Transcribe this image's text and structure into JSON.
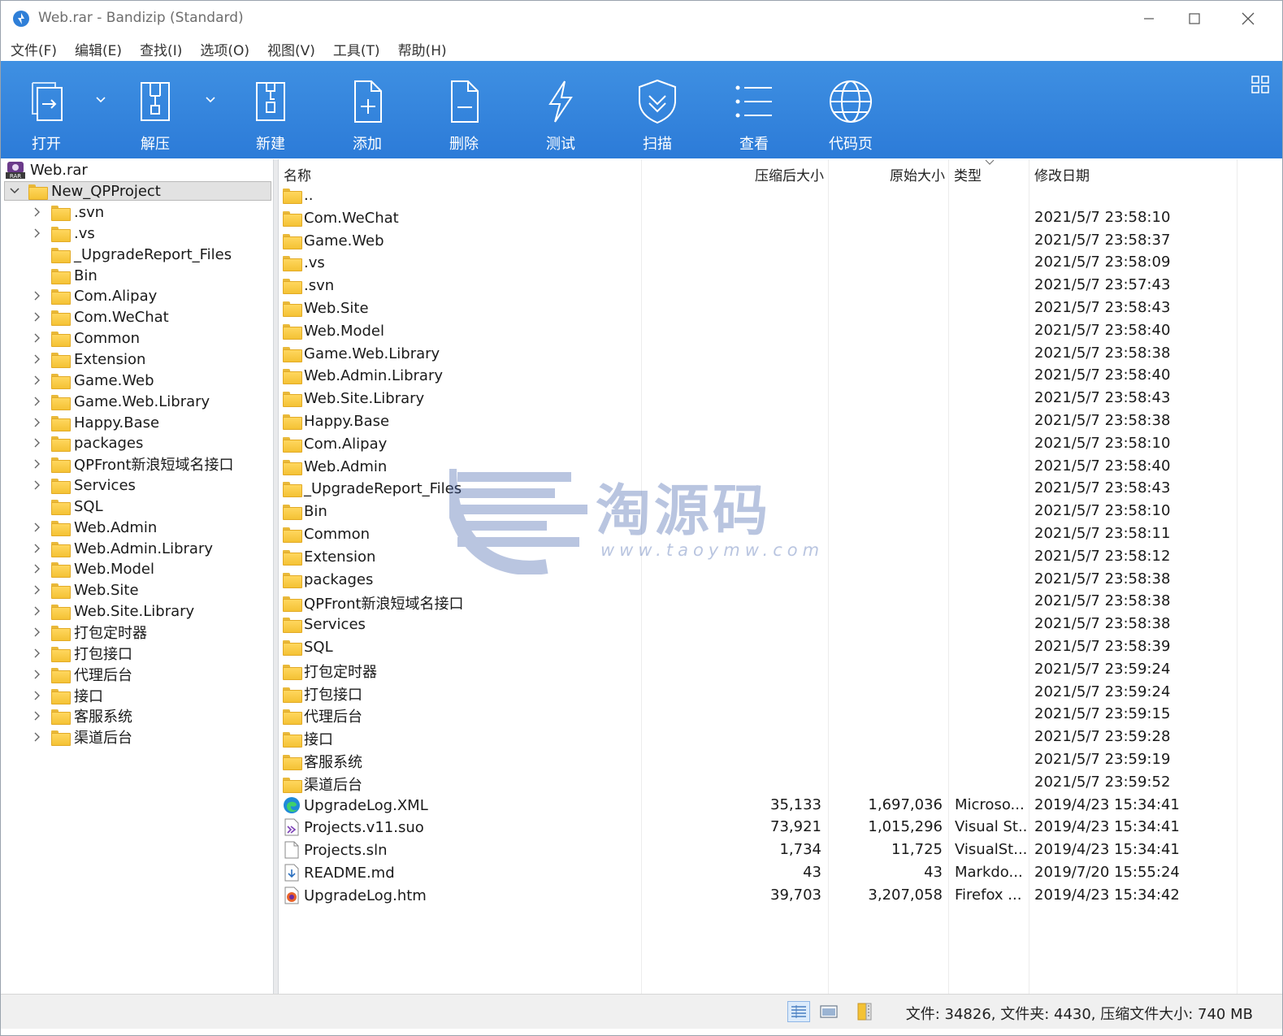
{
  "window": {
    "title": "Web.rar - Bandizip (Standard)"
  },
  "menu": [
    "文件(F)",
    "编辑(E)",
    "查找(I)",
    "选项(O)",
    "视图(V)",
    "工具(T)",
    "帮助(H)"
  ],
  "toolbar": {
    "open": "打开",
    "extract": "解压",
    "new": "新建",
    "add": "添加",
    "delete": "删除",
    "test": "测试",
    "scan": "扫描",
    "view": "查看",
    "codepage": "代码页"
  },
  "tree": {
    "root": "Web.rar",
    "selected": "New_QPProject",
    "children": [
      {
        "label": ".svn",
        "expandable": true
      },
      {
        "label": ".vs",
        "expandable": true
      },
      {
        "label": "_UpgradeReport_Files",
        "expandable": false
      },
      {
        "label": "Bin",
        "expandable": false
      },
      {
        "label": "Com.Alipay",
        "expandable": true
      },
      {
        "label": "Com.WeChat",
        "expandable": true
      },
      {
        "label": "Common",
        "expandable": true
      },
      {
        "label": "Extension",
        "expandable": true
      },
      {
        "label": "Game.Web",
        "expandable": true
      },
      {
        "label": "Game.Web.Library",
        "expandable": true
      },
      {
        "label": "Happy.Base",
        "expandable": true
      },
      {
        "label": "packages",
        "expandable": true
      },
      {
        "label": "QPFront新浪短域名接口",
        "expandable": true
      },
      {
        "label": "Services",
        "expandable": true
      },
      {
        "label": "SQL",
        "expandable": false
      },
      {
        "label": "Web.Admin",
        "expandable": true
      },
      {
        "label": "Web.Admin.Library",
        "expandable": true
      },
      {
        "label": "Web.Model",
        "expandable": true
      },
      {
        "label": "Web.Site",
        "expandable": true
      },
      {
        "label": "Web.Site.Library",
        "expandable": true
      },
      {
        "label": "打包定时器",
        "expandable": true
      },
      {
        "label": "打包接口",
        "expandable": true
      },
      {
        "label": "代理后台",
        "expandable": true
      },
      {
        "label": "接口",
        "expandable": true
      },
      {
        "label": "客服系统",
        "expandable": true
      },
      {
        "label": "渠道后台",
        "expandable": true
      }
    ]
  },
  "columns": {
    "name": "名称",
    "packed": "压缩后大小",
    "size": "原始大小",
    "type": "类型",
    "modified": "修改日期"
  },
  "files": [
    {
      "name": "..",
      "packed": "",
      "size": "",
      "type": "",
      "modified": "",
      "icon": "folder"
    },
    {
      "name": "Com.WeChat",
      "packed": "",
      "size": "",
      "type": "",
      "modified": "2021/5/7 23:58:10",
      "icon": "folder"
    },
    {
      "name": "Game.Web",
      "packed": "",
      "size": "",
      "type": "",
      "modified": "2021/5/7 23:58:37",
      "icon": "folder"
    },
    {
      "name": ".vs",
      "packed": "",
      "size": "",
      "type": "",
      "modified": "2021/5/7 23:58:09",
      "icon": "folder"
    },
    {
      "name": ".svn",
      "packed": "",
      "size": "",
      "type": "",
      "modified": "2021/5/7 23:57:43",
      "icon": "folder"
    },
    {
      "name": "Web.Site",
      "packed": "",
      "size": "",
      "type": "",
      "modified": "2021/5/7 23:58:43",
      "icon": "folder"
    },
    {
      "name": "Web.Model",
      "packed": "",
      "size": "",
      "type": "",
      "modified": "2021/5/7 23:58:40",
      "icon": "folder"
    },
    {
      "name": "Game.Web.Library",
      "packed": "",
      "size": "",
      "type": "",
      "modified": "2021/5/7 23:58:38",
      "icon": "folder"
    },
    {
      "name": "Web.Admin.Library",
      "packed": "",
      "size": "",
      "type": "",
      "modified": "2021/5/7 23:58:40",
      "icon": "folder"
    },
    {
      "name": "Web.Site.Library",
      "packed": "",
      "size": "",
      "type": "",
      "modified": "2021/5/7 23:58:43",
      "icon": "folder"
    },
    {
      "name": "Happy.Base",
      "packed": "",
      "size": "",
      "type": "",
      "modified": "2021/5/7 23:58:38",
      "icon": "folder"
    },
    {
      "name": "Com.Alipay",
      "packed": "",
      "size": "",
      "type": "",
      "modified": "2021/5/7 23:58:10",
      "icon": "folder"
    },
    {
      "name": "Web.Admin",
      "packed": "",
      "size": "",
      "type": "",
      "modified": "2021/5/7 23:58:40",
      "icon": "folder"
    },
    {
      "name": "_UpgradeReport_Files",
      "packed": "",
      "size": "",
      "type": "",
      "modified": "2021/5/7 23:58:43",
      "icon": "folder"
    },
    {
      "name": "Bin",
      "packed": "",
      "size": "",
      "type": "",
      "modified": "2021/5/7 23:58:10",
      "icon": "folder"
    },
    {
      "name": "Common",
      "packed": "",
      "size": "",
      "type": "",
      "modified": "2021/5/7 23:58:11",
      "icon": "folder"
    },
    {
      "name": "Extension",
      "packed": "",
      "size": "",
      "type": "",
      "modified": "2021/5/7 23:58:12",
      "icon": "folder"
    },
    {
      "name": "packages",
      "packed": "",
      "size": "",
      "type": "",
      "modified": "2021/5/7 23:58:38",
      "icon": "folder"
    },
    {
      "name": "QPFront新浪短域名接口",
      "packed": "",
      "size": "",
      "type": "",
      "modified": "2021/5/7 23:58:38",
      "icon": "folder"
    },
    {
      "name": "Services",
      "packed": "",
      "size": "",
      "type": "",
      "modified": "2021/5/7 23:58:38",
      "icon": "folder"
    },
    {
      "name": "SQL",
      "packed": "",
      "size": "",
      "type": "",
      "modified": "2021/5/7 23:58:39",
      "icon": "folder"
    },
    {
      "name": "打包定时器",
      "packed": "",
      "size": "",
      "type": "",
      "modified": "2021/5/7 23:59:24",
      "icon": "folder"
    },
    {
      "name": "打包接口",
      "packed": "",
      "size": "",
      "type": "",
      "modified": "2021/5/7 23:59:24",
      "icon": "folder"
    },
    {
      "name": "代理后台",
      "packed": "",
      "size": "",
      "type": "",
      "modified": "2021/5/7 23:59:15",
      "icon": "folder"
    },
    {
      "name": "接口",
      "packed": "",
      "size": "",
      "type": "",
      "modified": "2021/5/7 23:59:28",
      "icon": "folder"
    },
    {
      "name": "客服系统",
      "packed": "",
      "size": "",
      "type": "",
      "modified": "2021/5/7 23:59:19",
      "icon": "folder"
    },
    {
      "name": "渠道后台",
      "packed": "",
      "size": "",
      "type": "",
      "modified": "2021/5/7 23:59:52",
      "icon": "folder"
    },
    {
      "name": "UpgradeLog.XML",
      "packed": "35,133",
      "size": "1,697,036",
      "type": "Microso...",
      "modified": "2019/4/23 15:34:41",
      "icon": "edge"
    },
    {
      "name": "Projects.v11.suo",
      "packed": "73,921",
      "size": "1,015,296",
      "type": "Visual St...",
      "modified": "2019/4/23 15:34:41",
      "icon": "vs"
    },
    {
      "name": "Projects.sln",
      "packed": "1,734",
      "size": "11,725",
      "type": "VisualSt...",
      "modified": "2019/4/23 15:34:41",
      "icon": "doc"
    },
    {
      "name": "README.md",
      "packed": "43",
      "size": "43",
      "type": "Markdo...",
      "modified": "2019/7/20 15:55:24",
      "icon": "md"
    },
    {
      "name": "UpgradeLog.htm",
      "packed": "39,703",
      "size": "3,207,058",
      "type": "Firefox ...",
      "modified": "2019/4/23 15:34:42",
      "icon": "firefox"
    }
  ],
  "watermark": {
    "text": "淘源码",
    "url": "www.taoymw.com"
  },
  "status": {
    "text": "文件: 34826, 文件夹: 4430, 压缩文件大小: 740 MB"
  },
  "colors": {
    "toolbar": "#3388e0",
    "folder": "#f4c234",
    "selection": "#e2e2e2"
  }
}
